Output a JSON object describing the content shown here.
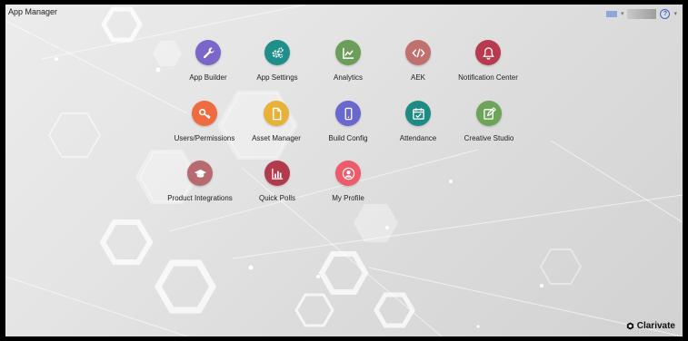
{
  "header": {
    "app_title": "App Manager",
    "help_symbol": "?"
  },
  "tiles": [
    {
      "label": "App Builder",
      "color": "#7b66c9",
      "icon": "wrench-icon"
    },
    {
      "label": "App Settings",
      "color": "#1f8f8a",
      "icon": "gears-icon"
    },
    {
      "label": "Analytics",
      "color": "#6b9e5b",
      "icon": "line-chart-icon"
    },
    {
      "label": "AEK",
      "color": "#c0716f",
      "icon": "code-icon"
    },
    {
      "label": "Notification Center",
      "color": "#b83a4f",
      "icon": "bell-icon"
    },
    {
      "label": "Users/Permissions",
      "color": "#ee6c3f",
      "icon": "key-icon"
    },
    {
      "label": "Asset Manager",
      "color": "#e8b23a",
      "icon": "file-icon"
    },
    {
      "label": "Build Config",
      "color": "#6a68cf",
      "icon": "mobile-icon"
    },
    {
      "label": "Attendance",
      "color": "#1e8a84",
      "icon": "calendar-check-icon"
    },
    {
      "label": "Creative Studio",
      "color": "#6ea35a",
      "icon": "edit-icon"
    },
    {
      "label": "Product Integrations",
      "color": "#b76a70",
      "icon": "graduation-cap-icon"
    },
    {
      "label": "Quick Polls",
      "color": "#b13a4d",
      "icon": "bar-chart-icon"
    },
    {
      "label": "My Profile",
      "color": "#ef5b6a",
      "icon": "user-circle-icon"
    }
  ],
  "footer": {
    "brand_name": "Clarivate",
    "brand_color": "#111111"
  }
}
